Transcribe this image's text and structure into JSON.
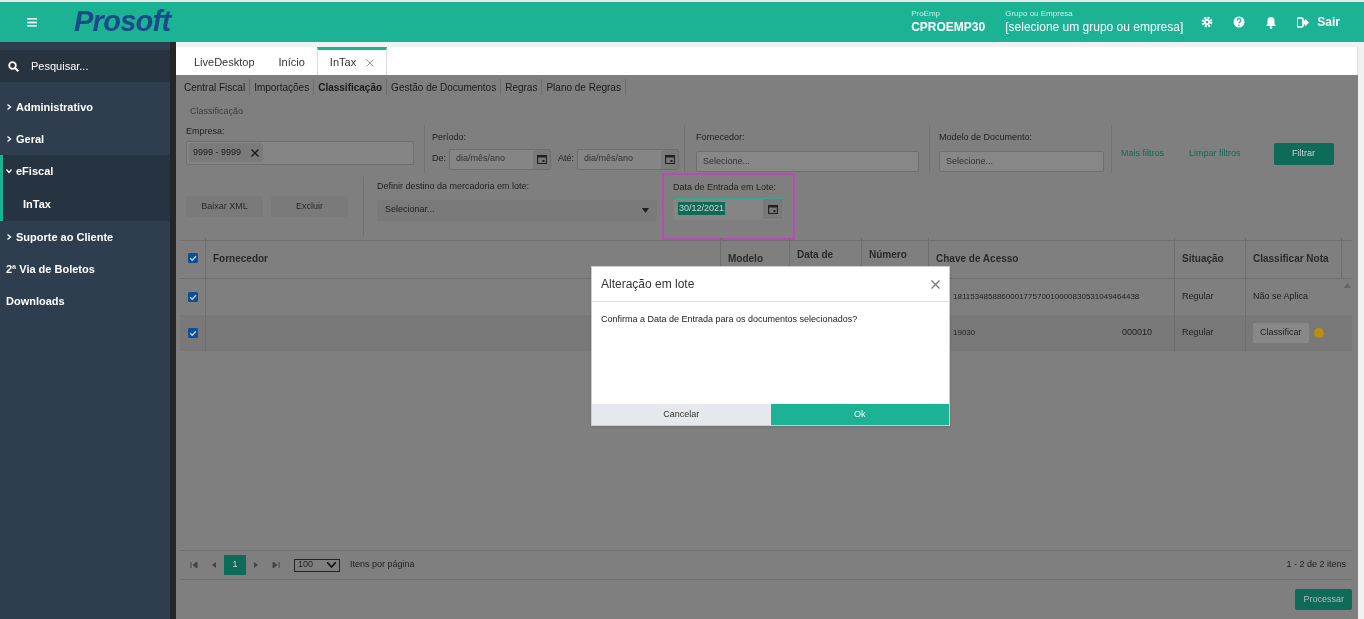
{
  "header": {
    "logo": "Prosoft",
    "menu_icon": "≡",
    "company_label": "ProEmp",
    "company": "CPROEMP30",
    "group_label": "Grupo ou Empresa",
    "group": "[selecione um grupo ou empresa]",
    "logout": "Sair"
  },
  "sidebar": {
    "search_placeholder": "Pesquisar...",
    "items": [
      {
        "label": "Administrativo",
        "kind": "group",
        "expanded": false
      },
      {
        "label": "Geral",
        "kind": "group",
        "expanded": false
      },
      {
        "label": "eFiscal",
        "kind": "group",
        "expanded": true,
        "children": [
          {
            "label": "InTax",
            "kind": "link"
          }
        ]
      },
      {
        "label": "Suporte ao Cliente",
        "kind": "group",
        "expanded": false
      },
      {
        "label": "2ª Via de Boletos",
        "kind": "link"
      },
      {
        "label": "Downloads",
        "kind": "link"
      }
    ]
  },
  "tabs": [
    {
      "label": "LiveDesktop",
      "selected": false
    },
    {
      "label": "Início",
      "selected": false
    },
    {
      "label": "InTax",
      "selected": true,
      "closable": true
    }
  ],
  "subnav": [
    {
      "label": "Central Fiscal",
      "selected": false
    },
    {
      "label": "Importações",
      "selected": false
    },
    {
      "label": "Classificação",
      "selected": true
    },
    {
      "label": "Gestão de Documentos",
      "selected": false
    },
    {
      "label": "Regras",
      "selected": false
    },
    {
      "label": "Plano de Regras",
      "selected": false
    }
  ],
  "breadcrumb": "Classificação",
  "filters": {
    "empresa_label": "Empresa:",
    "empresa_tag": "9999 - 9999",
    "periodo_label": "Período:",
    "de_label": "De:",
    "de_placeholder": "dia/mês/ano",
    "ate_label": "Até:",
    "ate_placeholder": "dia/mês/ano",
    "fornecedor_label": "Fornecedor:",
    "fornecedor_placeholder": "Selecione...",
    "modelo_label": "Modelo de Documento:",
    "modelo_placeholder": "Selecione...",
    "more_filters": "Mais filtros",
    "clear_filters": "Limpar filtros",
    "filter_button": "Filtrar"
  },
  "actions": {
    "buttons": [
      "Baixar XML",
      "Excluir"
    ],
    "destino_label": "Definir destino da mercadoria em lote:",
    "destino_value": "Selecionar...",
    "entrada_label": "Data de Entrada em Lote:",
    "entrada_value": "30/12/2021"
  },
  "table": {
    "all_checked": true,
    "columns": [
      "Fornecedor",
      "Modelo",
      "Data de",
      "Número",
      "Chave de Acesso",
      "Situação",
      "Classificar Nota"
    ],
    "rows": [
      {
        "checked": true,
        "chave": "181153485886000177570010000830531049464438",
        "situacao": "Regular",
        "classificar": {
          "kind": "text",
          "label": "Não se Aplica"
        }
      },
      {
        "checked": true,
        "chave": "19030",
        "chave_end": "000010",
        "situacao": "Regular",
        "classificar": {
          "kind": "button",
          "label": "Classificar",
          "color": "#b8900c"
        }
      }
    ]
  },
  "pager": {
    "page": "1",
    "page_size": "100",
    "per_page_label": "Itens por página",
    "summary": "1 - 2 de 2 itens"
  },
  "process_button": "Processar",
  "dialog": {
    "title": "Alteração em lote",
    "message": "Confirma a Data de Entrada para os documentos selecionados?",
    "cancel": "Cancelar",
    "ok": "Ok"
  }
}
